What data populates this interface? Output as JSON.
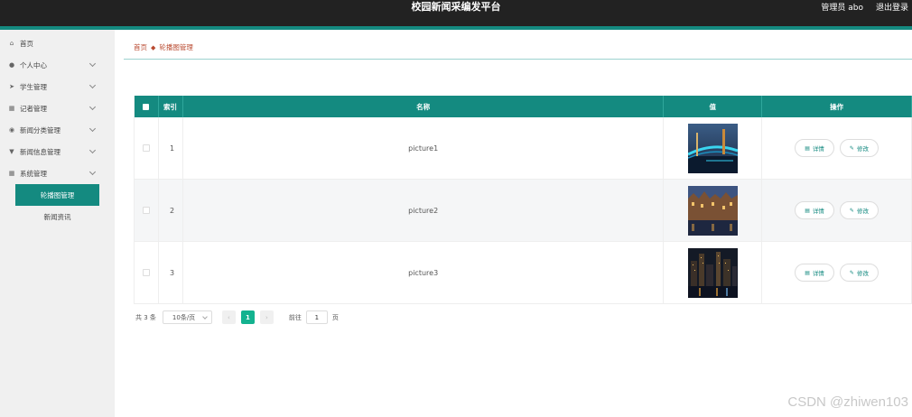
{
  "header": {
    "title": "校园新闻采编发平台",
    "user_label": "管理员 abo",
    "logout_label": "退出登录"
  },
  "sidebar": {
    "items": [
      {
        "label": "首页",
        "icon": "home-icon",
        "has_chevron": false
      },
      {
        "label": "个人中心",
        "icon": "user-icon",
        "has_chevron": true
      },
      {
        "label": "学生管理",
        "icon": "send-icon",
        "has_chevron": true
      },
      {
        "label": "记者管理",
        "icon": "grid-icon",
        "has_chevron": true
      },
      {
        "label": "新闻分类管理",
        "icon": "location-icon",
        "has_chevron": true
      },
      {
        "label": "新闻信息管理",
        "icon": "filter-icon",
        "has_chevron": true
      },
      {
        "label": "系统管理",
        "icon": "grid-icon",
        "has_chevron": true
      }
    ],
    "sub_items": [
      {
        "label": "轮播图管理",
        "active": true
      },
      {
        "label": "新闻资讯",
        "active": false
      }
    ]
  },
  "breadcrumb": {
    "home": "首页",
    "current": "轮播图管理"
  },
  "table": {
    "columns": [
      "索引",
      "名称",
      "值",
      "操作"
    ],
    "rows": [
      {
        "index": "1",
        "name": "picture1",
        "image": "night-bridge"
      },
      {
        "index": "2",
        "name": "picture2",
        "image": "night-canal-houses"
      },
      {
        "index": "3",
        "name": "picture3",
        "image": "night-city-skyline"
      }
    ],
    "detail_label": "详情",
    "edit_label": "修改"
  },
  "pagination": {
    "total": "共 3 条",
    "page_size": "10条/页",
    "current_page": "1",
    "goto_prefix": "前往",
    "goto_value": "1",
    "goto_suffix": "页"
  },
  "watermark": "CSDN @zhiwen103",
  "colors": {
    "primary": "#148a80",
    "topbar": "#222222",
    "page_active": "#13b28f"
  }
}
